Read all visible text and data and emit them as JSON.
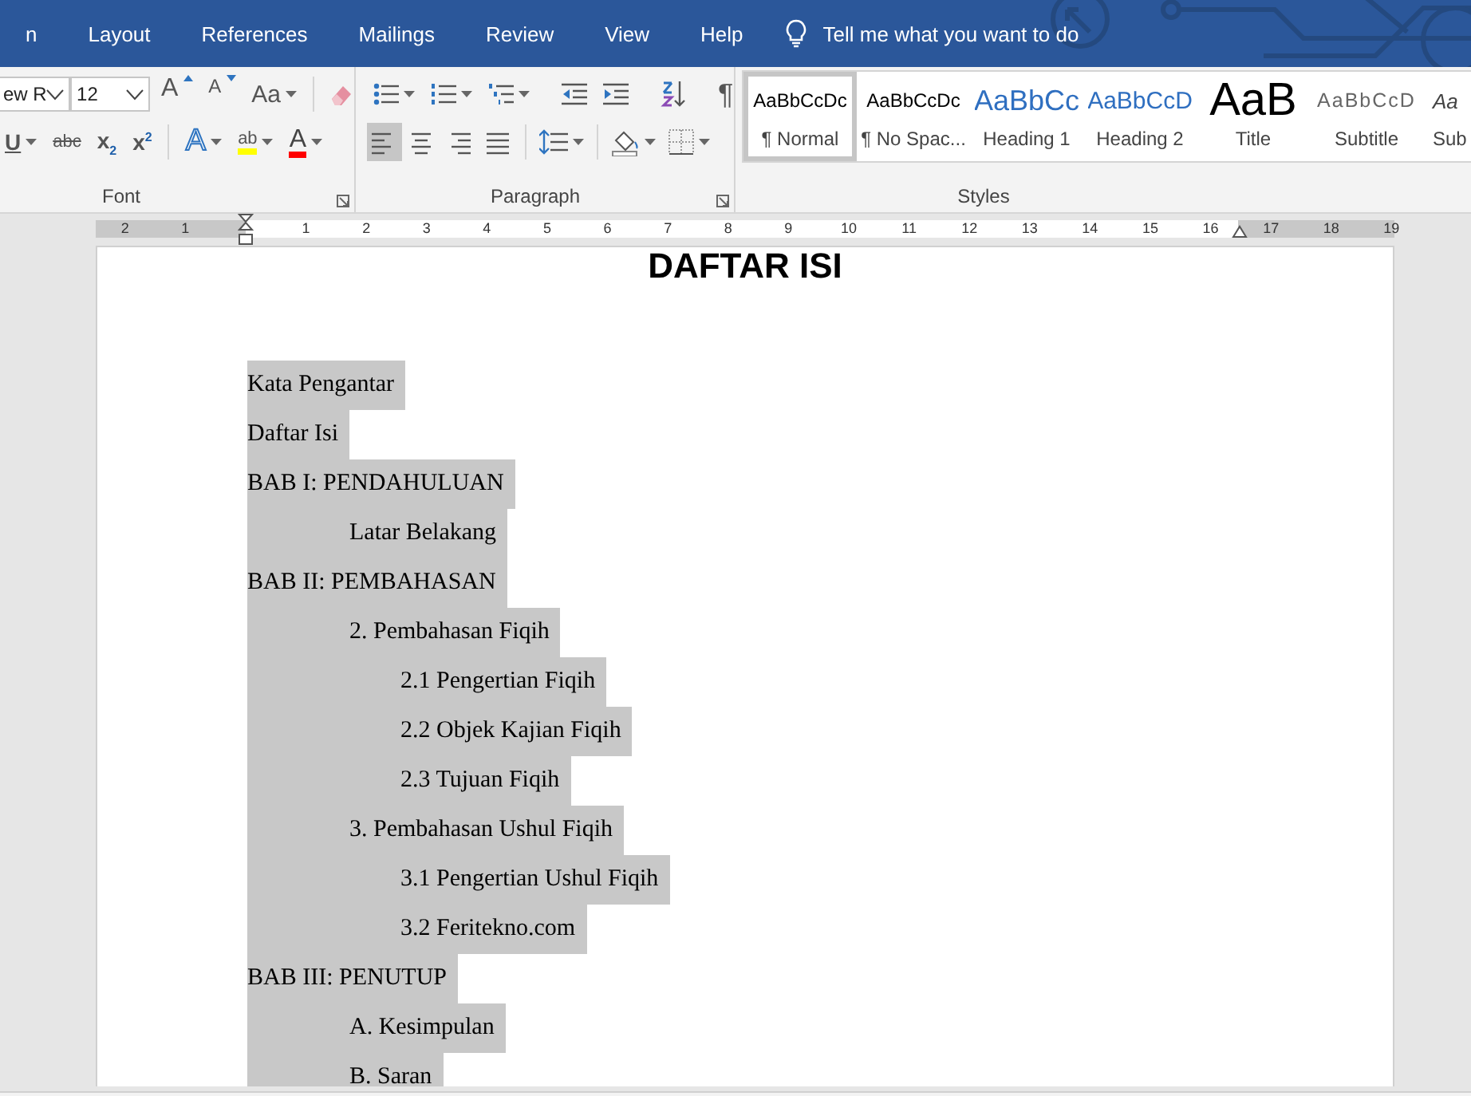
{
  "tabs": [
    {
      "label": "n"
    },
    {
      "label": "Layout"
    },
    {
      "label": "References"
    },
    {
      "label": "Mailings"
    },
    {
      "label": "Review"
    },
    {
      "label": "View"
    },
    {
      "label": "Help"
    }
  ],
  "tell_me": "Tell me what you want to do",
  "font_group": {
    "font_name": "ew R",
    "font_size": "12",
    "label": "Font",
    "row1": [
      {
        "label": "A",
        "kind": "grow"
      },
      {
        "label": "A",
        "kind": "shrink"
      },
      {
        "label": "Aa",
        "kind": "case"
      }
    ],
    "row2": [
      {
        "label": "U",
        "kind": "underline"
      },
      {
        "label": "abc",
        "kind": "strike"
      },
      {
        "label": "x$_{2}$",
        "kind": "script"
      },
      {
        "label": "x$^{2}$",
        "kind": "script"
      },
      {
        "label": "A",
        "kind": "effects"
      },
      {
        "label": "ab",
        "kind": "highlight"
      },
      {
        "label": "A",
        "kind": "color"
      }
    ]
  },
  "paragraph_group": {
    "label": "Paragraph",
    "pilcrow": "¶",
    "alignment": [
      {
        "kind": "left",
        "selected": true
      },
      {
        "kind": "center",
        "selected": false
      },
      {
        "kind": "right",
        "selected": false
      },
      {
        "kind": "justify",
        "selected": false
      }
    ]
  },
  "styles": {
    "label": "Styles",
    "items": [
      {
        "sample": "AaBbCcDc",
        "name": "¶ Normal",
        "kind": "normal",
        "selected": true
      },
      {
        "sample": "AaBbCcDc",
        "name": "¶ No Spac...",
        "kind": "normal",
        "selected": false
      },
      {
        "sample": "AaBbCc",
        "name": "Heading 1",
        "kind": "heading1",
        "selected": false
      },
      {
        "sample": "AaBbCcD",
        "name": "Heading 2",
        "kind": "heading2",
        "selected": false
      },
      {
        "sample": "AaB",
        "name": "Title",
        "kind": "title",
        "selected": false
      },
      {
        "sample": "AaBbCcD",
        "name": "Subtitle",
        "kind": "subtitle",
        "selected": false
      },
      {
        "sample": "Aa",
        "name": "Sub",
        "kind": "emphasis",
        "selected": false
      }
    ]
  },
  "ruler": {
    "left_labels": [
      "2",
      "1"
    ],
    "labels": [
      "1",
      "2",
      "3",
      "4",
      "5",
      "6",
      "7",
      "8",
      "9",
      "10",
      "11",
      "12",
      "13",
      "14",
      "15",
      "16"
    ],
    "right_labels": [
      "17",
      "18",
      "19"
    ]
  },
  "document": {
    "title": "DAFTAR ISI",
    "entries": [
      {
        "text": "Kata Pengantar",
        "highlighted": true
      },
      {
        "text": "Daftar Isi",
        "highlighted": true
      },
      {
        "text": "BAB I: PENDAHULUAN",
        "highlighted": true,
        "children": [
          {
            "text": "Latar Belakang",
            "highlighted": true
          }
        ]
      },
      {
        "text": "BAB II: PEMBAHASAN",
        "highlighted": true,
        "children": [
          {
            "text": "2. Pembahasan Fiqih",
            "highlighted": true,
            "children": [
              {
                "text": "2.1 Pengertian Fiqih",
                "highlighted": true
              },
              {
                "text": "2.2 Objek Kajian Fiqih",
                "highlighted": true
              },
              {
                "text": "2.3 Tujuan Fiqih",
                "highlighted": true
              }
            ]
          },
          {
            "text": "3. Pembahasan Ushul Fiqih",
            "highlighted": true,
            "children": [
              {
                "text": "3.1 Pengertian Ushul Fiqih",
                "highlighted": true
              },
              {
                "text": "3.2 Feritekno.com",
                "highlighted": true
              }
            ]
          }
        ]
      },
      {
        "text": "BAB III: PENUTUP",
        "highlighted": true,
        "children": [
          {
            "text": "A. Kesimpulan",
            "highlighted": true
          },
          {
            "text": "B. Saran",
            "highlighted": true
          }
        ]
      }
    ]
  }
}
